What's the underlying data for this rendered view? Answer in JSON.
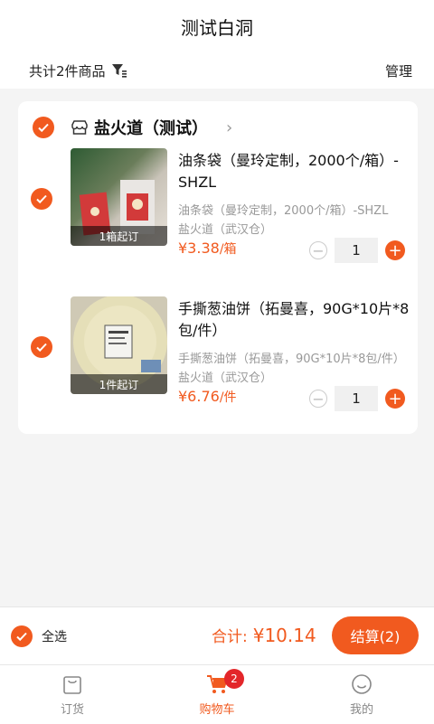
{
  "header": {
    "title": "测试白洞"
  },
  "subbar": {
    "count_label": "共计2件商品",
    "manage_label": "管理"
  },
  "shop": {
    "name": "盐火道（测试）"
  },
  "items": [
    {
      "title": "油条袋（曼玲定制，2000个/箱）-SHZL",
      "spec": "油条袋（曼玲定制，2000个/箱）-SHZL",
      "warehouse": "盐火道（武汉仓）",
      "price": "¥3.38",
      "unit": "/箱",
      "min_order": "1箱起订",
      "qty": "1"
    },
    {
      "title": "手撕葱油饼（拓曼喜，90G*10片*8包/件）",
      "spec": "手撕葱油饼（拓曼喜，90G*10片*8包/件）",
      "warehouse": "盐火道（武汉仓）",
      "price": "¥6.76",
      "unit": "/件",
      "min_order": "1件起订",
      "qty": "1"
    }
  ],
  "footer": {
    "select_all": "全选",
    "total_label": "合计:",
    "total_amount": "¥10.14",
    "settle_label": "结算(2)"
  },
  "tabs": [
    {
      "label": "订货",
      "icon": "bag-icon"
    },
    {
      "label": "购物车",
      "icon": "cart-icon",
      "badge": "2"
    },
    {
      "label": "我的",
      "icon": "smile-icon"
    }
  ],
  "colors": {
    "accent": "#f15a1f",
    "badge": "#e3262a"
  }
}
